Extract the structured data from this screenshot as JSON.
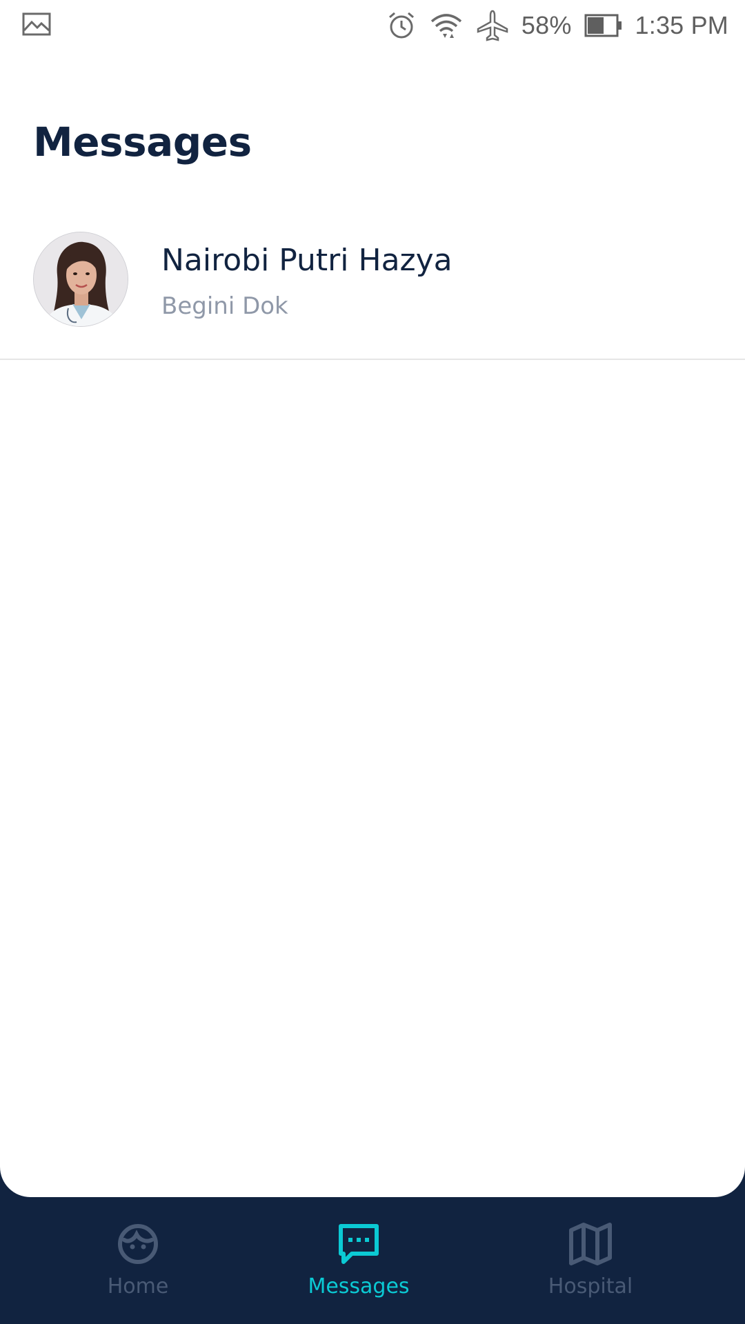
{
  "status_bar": {
    "battery_percent": "58%",
    "battery_level": 0.58,
    "time": "1:35 PM",
    "icons": [
      "image-icon",
      "alarm-icon",
      "wifi-icon",
      "airplane-icon",
      "battery-icon"
    ]
  },
  "page": {
    "title": "Messages"
  },
  "messages": [
    {
      "name": "Nairobi Putri Hazya",
      "preview": "Begini Dok",
      "avatar": "doctor-avatar"
    }
  ],
  "bottom_nav": {
    "items": [
      {
        "label": "Home",
        "icon": "face-icon",
        "active": false
      },
      {
        "label": "Messages",
        "icon": "chat-icon",
        "active": true
      },
      {
        "label": "Hospital",
        "icon": "map-icon",
        "active": false
      }
    ]
  },
  "colors": {
    "primary_dark": "#112340",
    "accent": "#0bcad4",
    "inactive": "#495a75",
    "secondary_text": "#8f98a8"
  }
}
